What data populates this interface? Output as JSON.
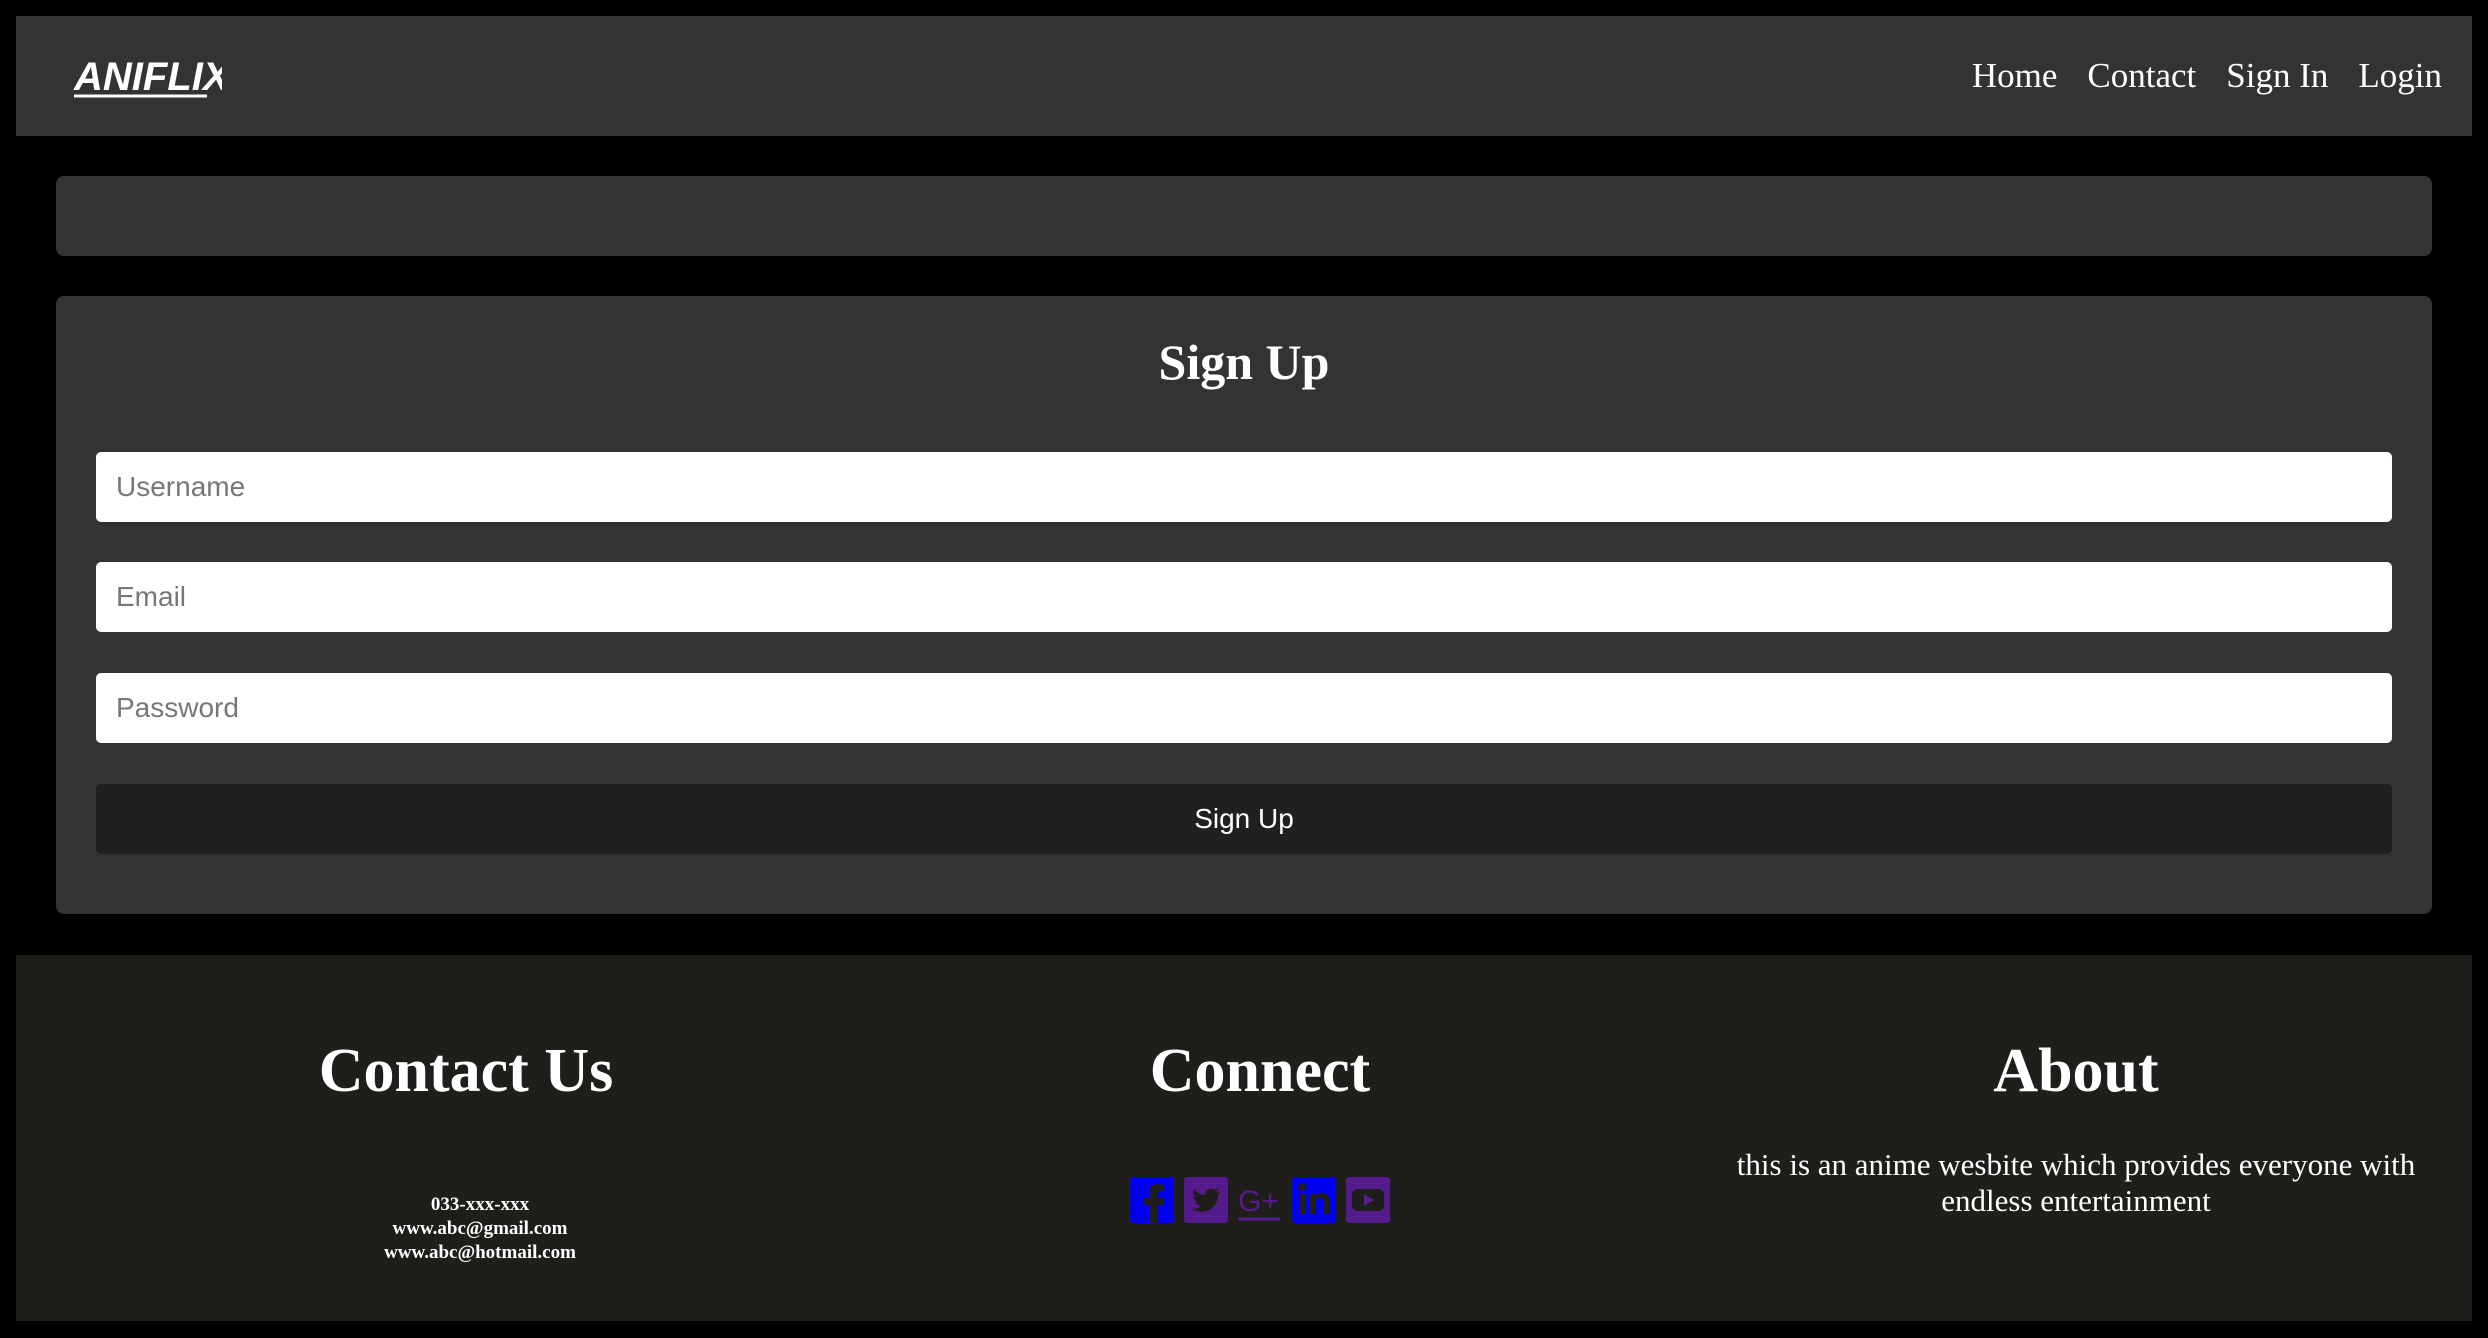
{
  "brand": {
    "logo_text": "ANIFLIX",
    "logo_icon": "aniflix-logo"
  },
  "nav": {
    "items": [
      {
        "label": "Home"
      },
      {
        "label": "Contact"
      },
      {
        "label": "Sign In"
      },
      {
        "label": "Login"
      }
    ]
  },
  "signup": {
    "title": "Sign Up",
    "username_placeholder": "Username",
    "email_placeholder": "Email",
    "password_placeholder": "Password",
    "button_label": "Sign Up"
  },
  "footer": {
    "contact": {
      "heading": "Contact Us",
      "phone": "033-xxx-xxx",
      "email1": "www.abc@gmail.com",
      "email2": "www.abc@hotmail.com"
    },
    "connect": {
      "heading": "Connect",
      "icons": [
        "facebook-icon",
        "twitter-icon",
        "google-plus-icon",
        "linkedin-icon",
        "youtube-icon"
      ]
    },
    "about": {
      "heading": "About",
      "text": "this is an anime wesbite which provides everyone with endless entertainment"
    }
  },
  "colors": {
    "page_bg": "#000000",
    "panel_bg": "#333333",
    "footer_bg": "#1f1e1b",
    "button_bg": "#202020",
    "icon_blue": "#0000ee",
    "icon_purple": "#551a8b"
  }
}
